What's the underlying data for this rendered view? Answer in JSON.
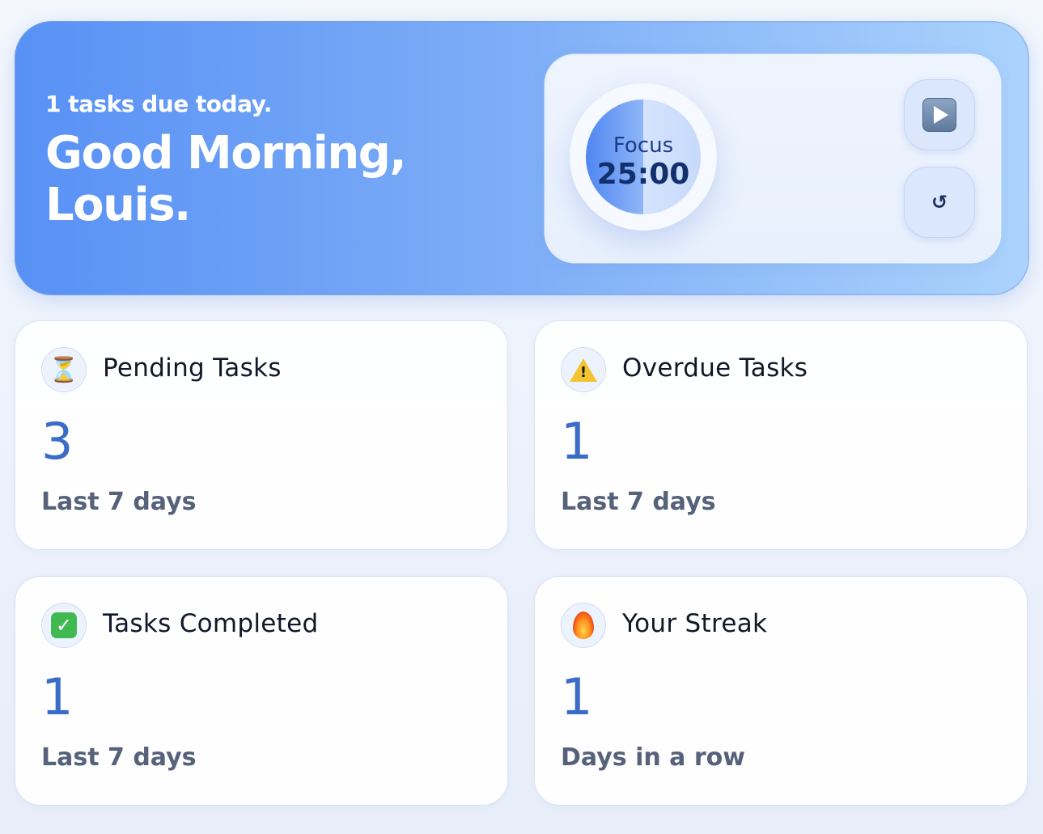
{
  "hero": {
    "subtitle": "1 tasks due today.",
    "greeting_line1": "Good Morning,",
    "greeting_line2": "Louis."
  },
  "timer": {
    "mode_label": "Focus",
    "time": "25:00",
    "progress": 0.5,
    "play_icon": "play-icon",
    "reset_icon": "reset-icon",
    "reset_glyph": "↺"
  },
  "cards": [
    {
      "icon": "hourglass-icon",
      "icon_glyph": "⏳",
      "title": "Pending Tasks",
      "value": "3",
      "footer": "Last 7 days"
    },
    {
      "icon": "warning-icon",
      "icon_glyph": "!",
      "title": "Overdue Tasks",
      "value": "1",
      "footer": "Last 7 days"
    },
    {
      "icon": "check-icon",
      "icon_glyph": "✓",
      "title": "Tasks Completed",
      "value": "1",
      "footer": "Last 7 days"
    },
    {
      "icon": "fire-icon",
      "title": "Your Streak",
      "value": "1",
      "footer": "Days in a row"
    }
  ],
  "colors": {
    "accent": "#5891f5",
    "value_blue": "#3a6cc8",
    "dial_dark": "#13306e"
  }
}
